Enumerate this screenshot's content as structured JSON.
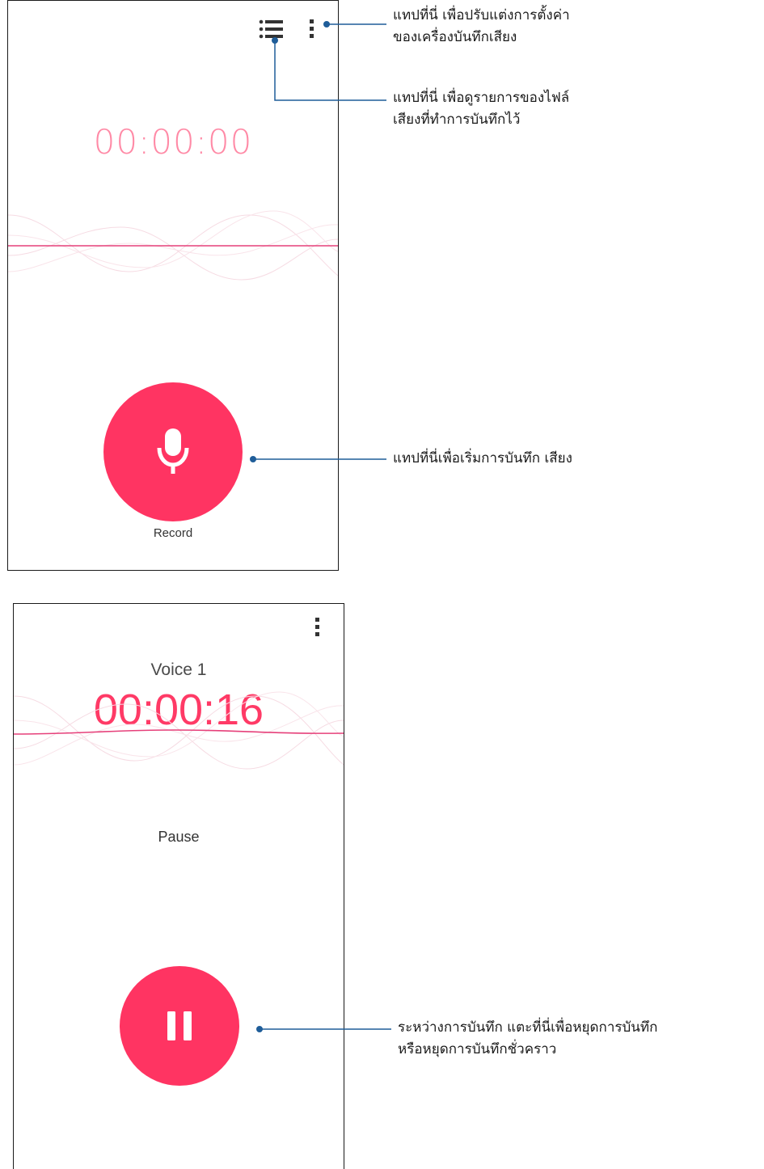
{
  "screen_idle": {
    "timer": "00:00:00",
    "record_label": "Record"
  },
  "screen_recording": {
    "recording_name": "Voice 1",
    "timer": "00:00:16",
    "pause_label": "Pause"
  },
  "annotations": {
    "settings": [
      "แทปที่นี่ เพื่อปรับแต่งการตั้งค่า",
      "ของเครื่องบันทึกเสียง"
    ],
    "recordings_list": [
      "แทปที่นี่ เพื่อดูรายการของไฟล์",
      "เสียงที่ทำการบันทึกไว้"
    ],
    "start_recording": [
      "แทปที่นี่เพื่อเริ่มการบันทึก เสียง"
    ],
    "pause_recording": [
      "ระหว่างการบันทึก แตะที่นี่เพื่อหยุดการบันทึก",
      "หรือหยุดการบันทึกชั่วคราว"
    ]
  },
  "icons": {
    "list": "list-icon",
    "more": "more-vert-icon",
    "mic": "microphone-icon",
    "pause": "pause-icon"
  },
  "colors": {
    "accent": "#ff3462",
    "timer_idle": "#ff8aa6",
    "callout": "#1f5d99"
  }
}
